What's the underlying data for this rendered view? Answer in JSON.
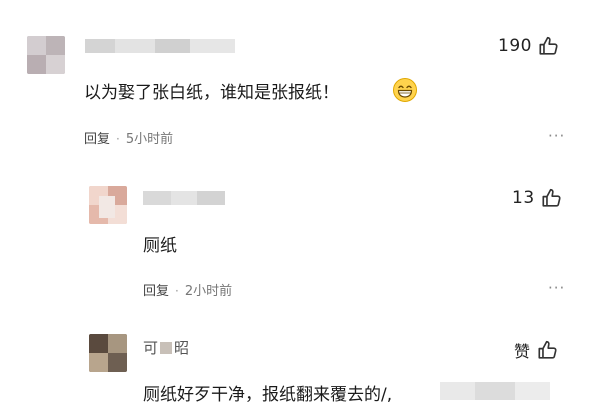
{
  "comments": [
    {
      "likes": "190",
      "text": "以为娶了张白纸，谁知是张报纸！",
      "emoji": "grinning-face",
      "reply_label": "回复",
      "separator": "·",
      "time": "5小时前",
      "more": "···"
    },
    {
      "likes": "13",
      "text": "厕纸",
      "reply_label": "回复",
      "separator": "·",
      "time": "2小时前",
      "more": "···"
    },
    {
      "likes": "赞",
      "username_visible": "可",
      "username_suffix": "昭",
      "text": "厕纸好歹干净，报纸翻来覆去的/,"
    }
  ],
  "colors": {
    "text": "#1a1a1a",
    "meta": "#777777",
    "blur": "#d9d9d9"
  }
}
